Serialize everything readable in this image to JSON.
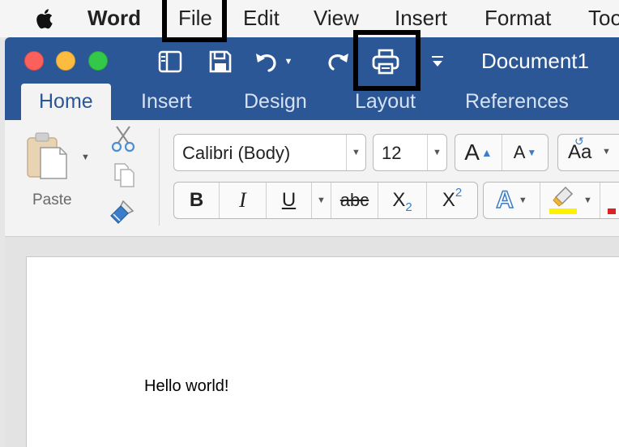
{
  "menubar": {
    "app_name": "Word",
    "items": [
      "File",
      "Edit",
      "View",
      "Insert",
      "Format",
      "Tools"
    ]
  },
  "window": {
    "title": "Document1",
    "quick_access": [
      "sidebar-icon",
      "save-icon",
      "undo-icon",
      "redo-icon",
      "print-icon",
      "customize-icon"
    ]
  },
  "tabs": [
    "Home",
    "Insert",
    "Design",
    "Layout",
    "References"
  ],
  "ribbon": {
    "paste_label": "Paste",
    "font_name": "Calibri (Body)",
    "font_size": "12",
    "grow_font": "A",
    "shrink_font": "A",
    "change_case": "Aa",
    "bold": "B",
    "italic": "I",
    "underline": "U",
    "strikethrough": "abc",
    "subscript": "X",
    "subscript_mark": "2",
    "superscript": "X",
    "superscript_mark": "2",
    "text_effects": "A"
  },
  "document": {
    "text": "Hello world!"
  },
  "colors": {
    "title_bar": "#2b5797",
    "ribbon": "#f3f3f3",
    "close": "#fc605c",
    "minimize": "#fdbc40",
    "zoom": "#34c84a",
    "highlight": "#fff200"
  }
}
